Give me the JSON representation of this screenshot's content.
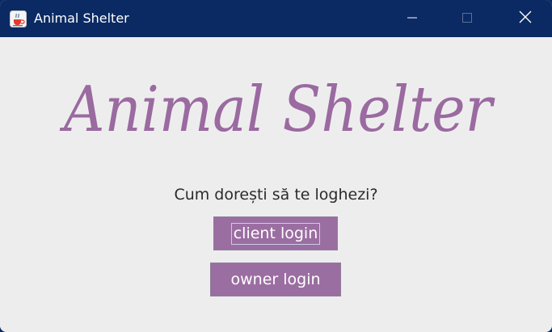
{
  "window": {
    "title": "Animal Shelter",
    "app_icon": "java-cup-icon",
    "controls": {
      "minimize_icon": "minimize-icon",
      "maximize_icon": "maximize-icon",
      "close_icon": "close-icon"
    }
  },
  "main": {
    "logo_text": "Animal Shelter",
    "prompt": "Cum dorești să te loghezi?",
    "client_login_label": "client login",
    "owner_login_label": "owner login"
  },
  "colors": {
    "titlebar": "#0b2a63",
    "background": "#eeedee",
    "accent": "#9b6ea2",
    "logo": "#9a6aa0"
  }
}
